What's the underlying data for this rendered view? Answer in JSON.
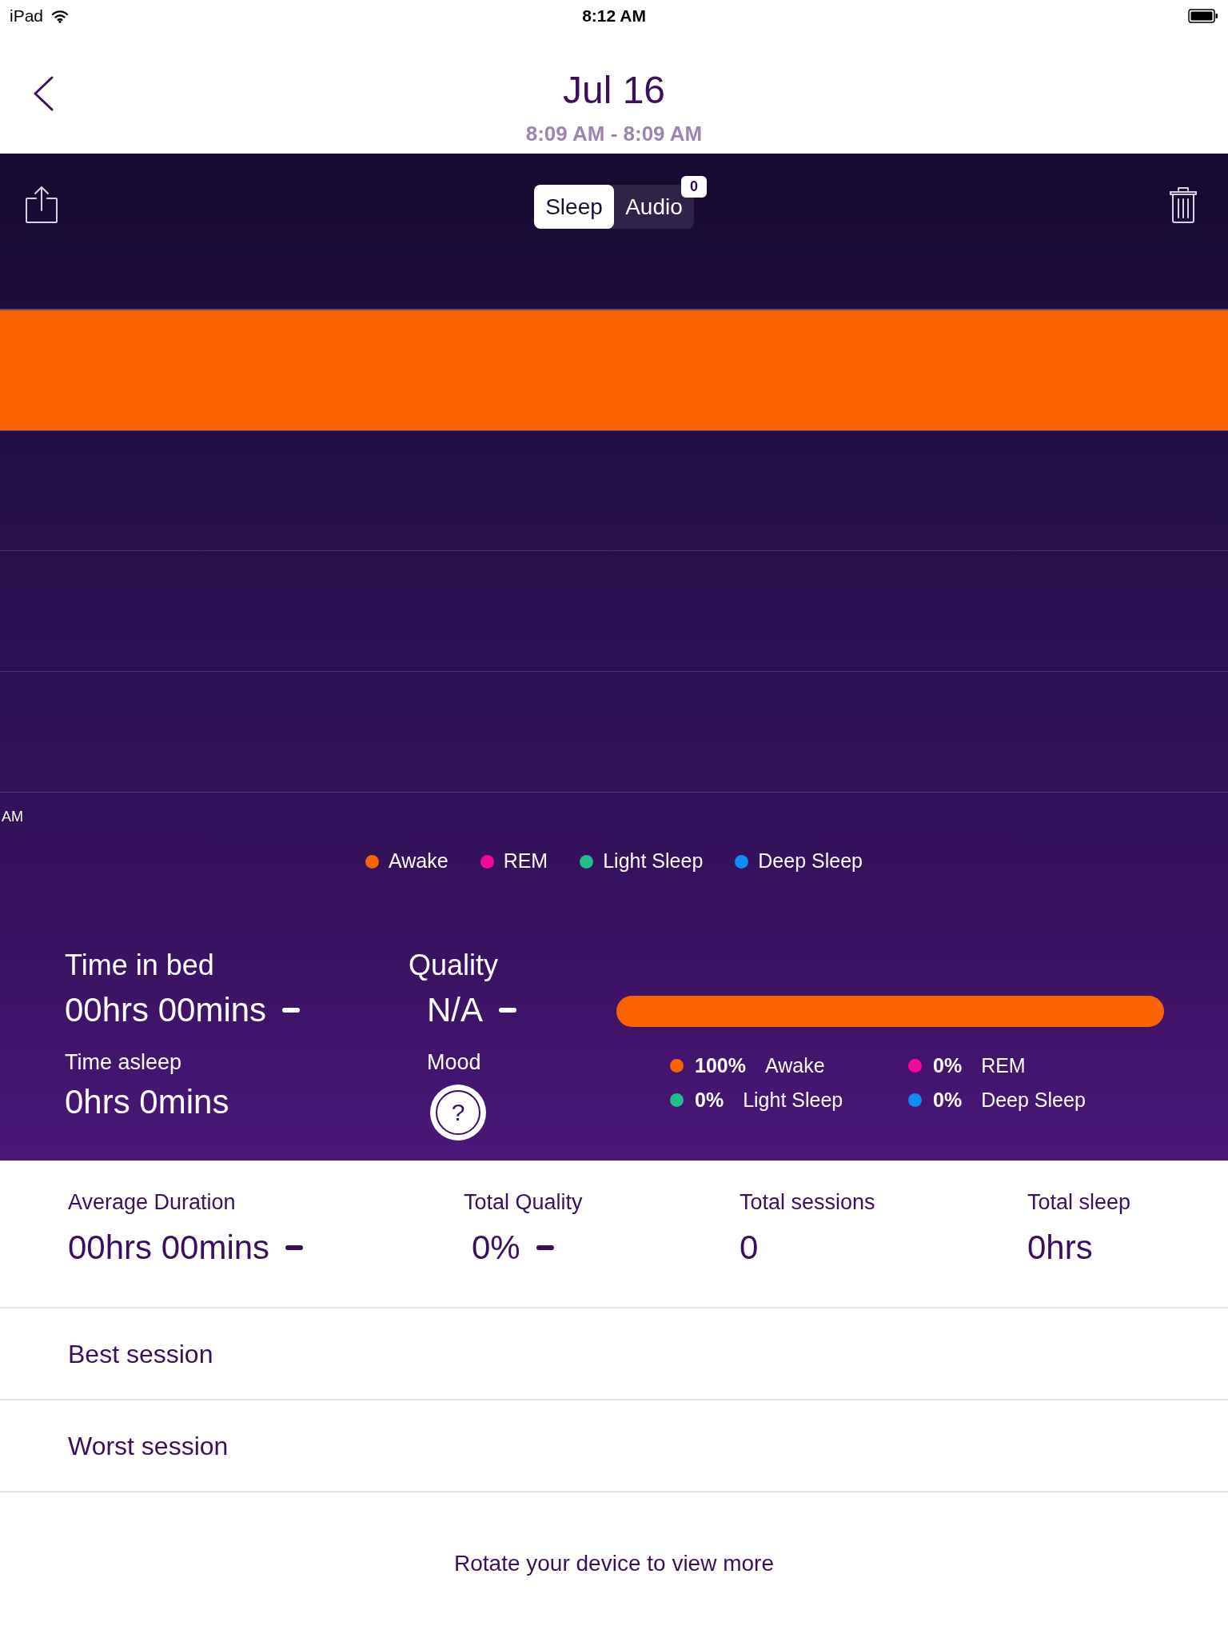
{
  "status_bar": {
    "device": "iPad",
    "time": "8:12 AM"
  },
  "nav": {
    "title": "Jul 16",
    "subtitle": "8:09 AM - 8:09 AM"
  },
  "tabs": [
    {
      "label": "Sleep",
      "selected": true
    },
    {
      "label": "Audio",
      "selected": false,
      "badge": "0"
    }
  ],
  "hypnogram": {
    "time_label": "AM"
  },
  "legend": [
    {
      "label": "Awake",
      "color": "#f96400"
    },
    {
      "label": "REM",
      "color": "#f4099b"
    },
    {
      "label": "Light Sleep",
      "color": "#20bf8a"
    },
    {
      "label": "Deep Sleep",
      "color": "#0b8ff6"
    }
  ],
  "session_stats": {
    "time_in_bed": {
      "label": "Time in bed",
      "value": "00hrs 00mins",
      "trend_marker": true
    },
    "time_asleep": {
      "label": "Time asleep",
      "value": "0hrs 0mins",
      "trend_marker": false
    },
    "quality": {
      "label": "Quality",
      "value": "N/A",
      "trend_marker": true
    },
    "mood": {
      "label": "Mood",
      "value": "?"
    }
  },
  "stage_breakdown": [
    {
      "percent": "100%",
      "label": "Awake",
      "color": "#f96400",
      "level": 1
    },
    {
      "percent": "0%",
      "label": "REM",
      "color": "#f4099b"
    },
    {
      "percent": "0%",
      "label": "Light Sleep",
      "color": "#20bf8a"
    },
    {
      "percent": "0%",
      "label": "Deep Sleep",
      "color": "#0b8ff6"
    }
  ],
  "summary": [
    {
      "label": "Average Duration",
      "value": "00hrs 00mins",
      "trend_marker": true
    },
    {
      "label": "Total Quality",
      "value": "0%",
      "trend_marker": true
    },
    {
      "label": "Total sessions",
      "value": "0",
      "trend_marker": false
    },
    {
      "label": "Total sleep",
      "value": "0hrs",
      "trend_marker": false
    }
  ],
  "session_rows": [
    "Best session",
    "Worst session"
  ],
  "footer_hint": "Rotate your device to view more"
}
